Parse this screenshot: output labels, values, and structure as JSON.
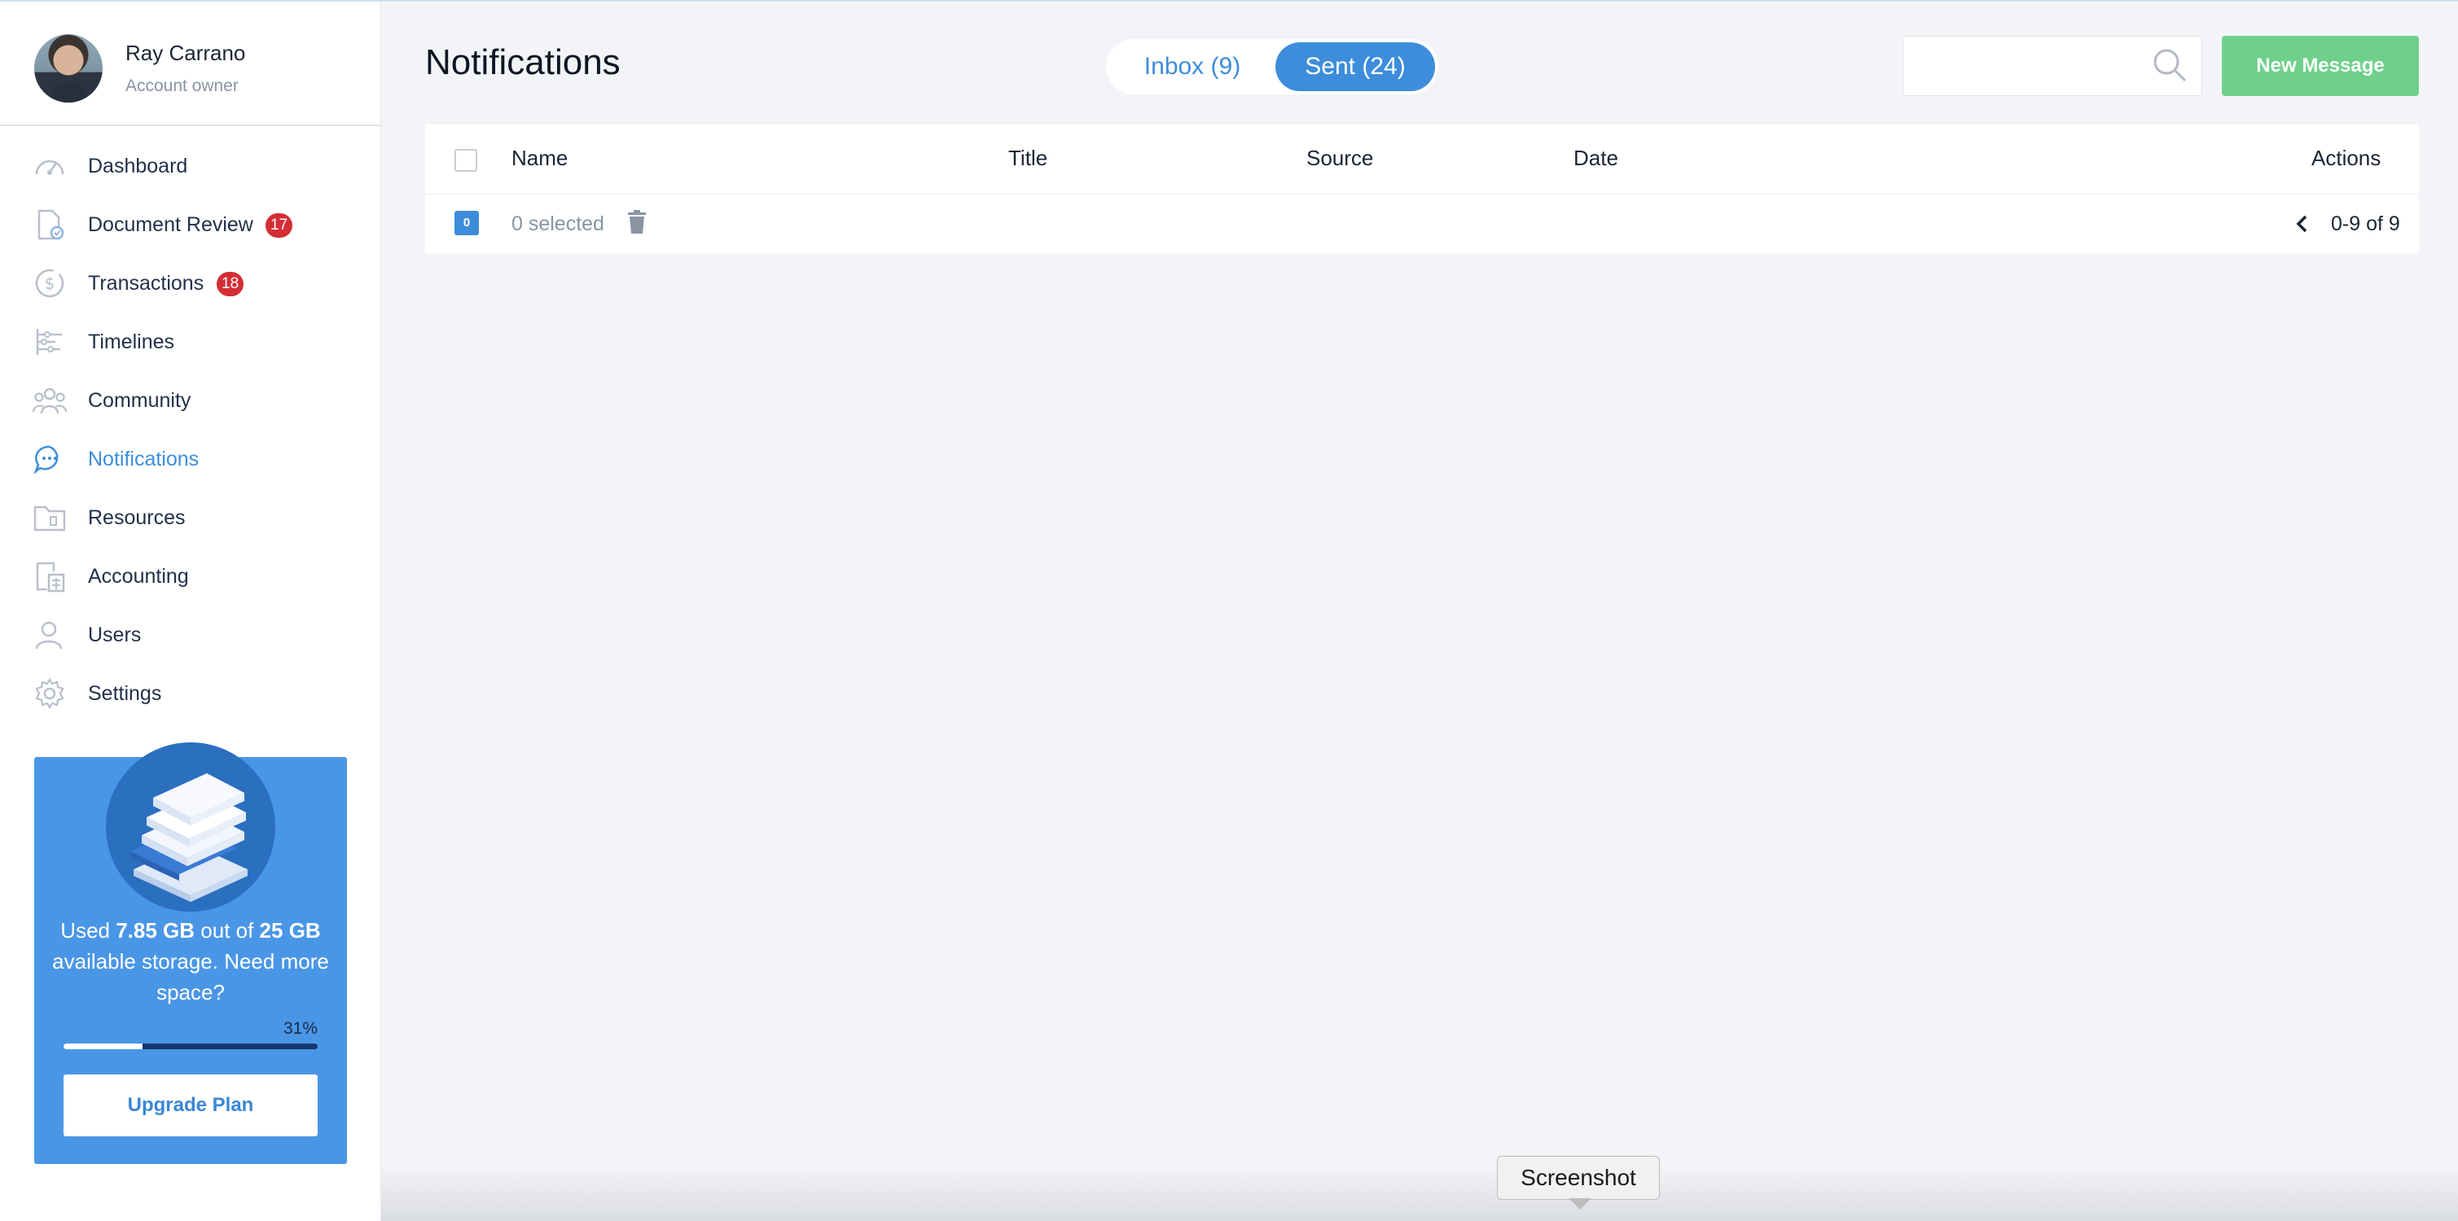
{
  "profile": {
    "name": "Ray Carrano",
    "role": "Account owner"
  },
  "nav": {
    "items": [
      {
        "label": "Dashboard",
        "icon": "speedometer-icon",
        "active": false
      },
      {
        "label": "Document Review",
        "icon": "document-check-icon",
        "badge": "17",
        "active": false
      },
      {
        "label": "Transactions",
        "icon": "dollar-circle-icon",
        "badge": "18",
        "active": false
      },
      {
        "label": "Timelines",
        "icon": "timeline-icon",
        "active": false
      },
      {
        "label": "Community",
        "icon": "community-icon",
        "active": false
      },
      {
        "label": "Notifications",
        "icon": "chat-bubble-icon",
        "active": true
      },
      {
        "label": "Resources",
        "icon": "folder-icon",
        "active": false
      },
      {
        "label": "Accounting",
        "icon": "calculator-icon",
        "active": false
      },
      {
        "label": "Users",
        "icon": "user-icon",
        "active": false
      },
      {
        "label": "Settings",
        "icon": "gear-icon",
        "active": false
      }
    ]
  },
  "storage": {
    "used_prefix": "Used ",
    "used": "7.85 GB",
    "mid": " out of ",
    "total": "25 GB",
    "suffix": " available storage. Need more space?",
    "percent_label": "31%",
    "percent": 31,
    "upgrade_label": "Upgrade Plan"
  },
  "header": {
    "title": "Notifications",
    "tabs": [
      {
        "label": "Inbox (9)",
        "active": false
      },
      {
        "label": "Sent (24)",
        "active": true
      }
    ],
    "search": {
      "value": "",
      "placeholder": ""
    },
    "new_message_label": "New Message"
  },
  "table": {
    "columns": [
      "Name",
      "Title",
      "Source",
      "Date",
      "Actions"
    ],
    "selected_count": "0",
    "selected_text": "0 selected",
    "pagination": "0-9 of 9"
  },
  "tooltip": {
    "text": "Screenshot"
  },
  "colors": {
    "accent": "#3d8ddb",
    "badge": "#d42e35",
    "new_message": "#6fd08b",
    "storage_card": "#4a96e6"
  }
}
